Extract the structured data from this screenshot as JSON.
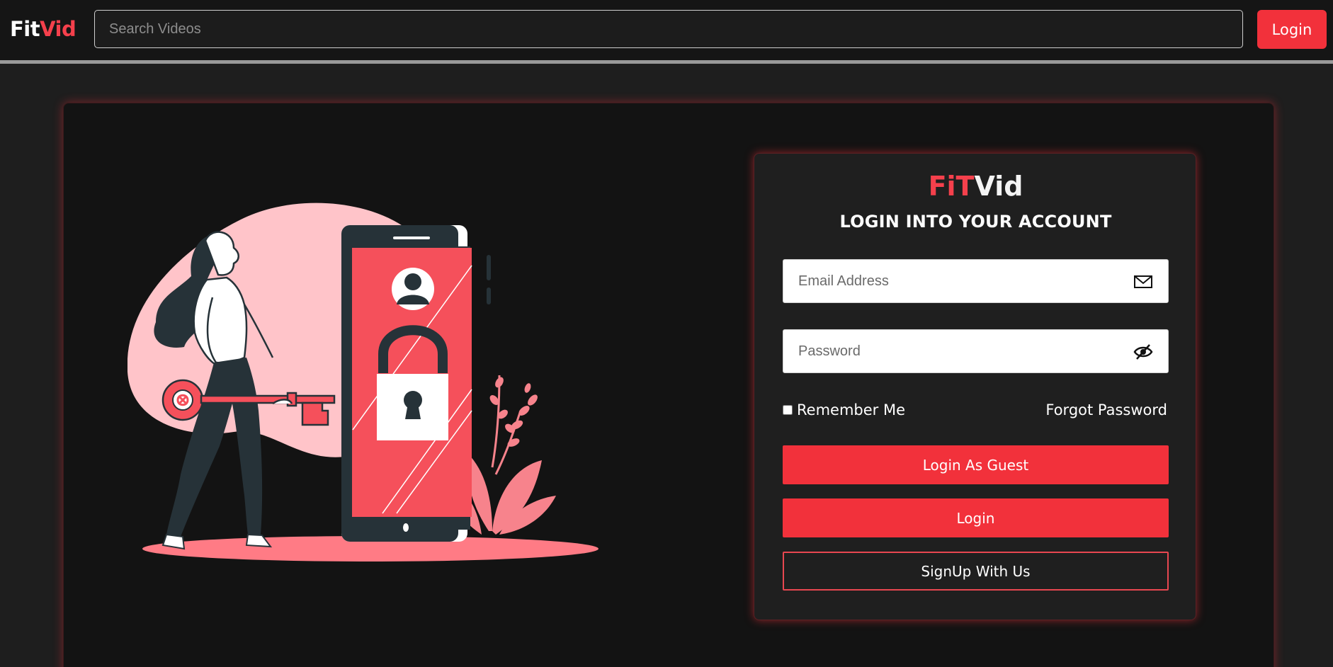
{
  "navbar": {
    "brand_part1": "Fit",
    "brand_part2": "Vid",
    "search_placeholder": "Search Videos",
    "login_label": "Login"
  },
  "login_card": {
    "brand_part1": "FiT",
    "brand_part2": "Vid",
    "title": "LOGIN INTO YOUR ACCOUNT",
    "email_placeholder": "Email Address",
    "email_icon": "mail-icon",
    "password_placeholder": "Password",
    "password_icon": "eye-slash-icon",
    "remember_label": "Remember Me",
    "remember_checked": false,
    "forgot_label": "Forgot Password",
    "guest_button": "Login As Guest",
    "login_button": "Login",
    "signup_button": "SignUp With Us"
  },
  "colors": {
    "accent": "#f2313b",
    "background": "#1e1e1e",
    "card": "#1f1f1f",
    "illustration_pink": "#ffc4c9",
    "illustration_red": "#f5505b",
    "illustration_dark": "#263238"
  }
}
